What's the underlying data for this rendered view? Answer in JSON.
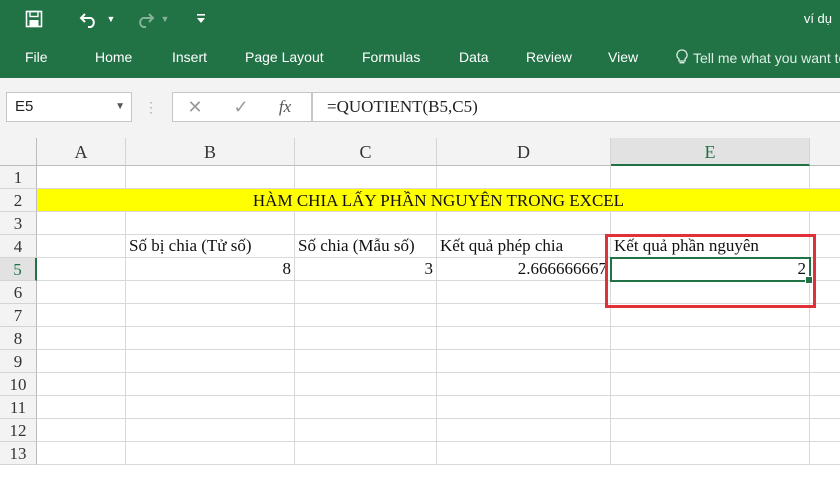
{
  "window": {
    "title": "ví dụ",
    "quick_access": {
      "save_icon": "save-icon",
      "undo_icon": "undo-icon",
      "redo_icon": "redo-icon",
      "customize_icon": "customize-icon"
    }
  },
  "ribbon": {
    "tabs": [
      "File",
      "Home",
      "Insert",
      "Page Layout",
      "Formulas",
      "Data",
      "Review",
      "View"
    ],
    "tell_me": "Tell me what you want to do"
  },
  "formula_bar": {
    "name_box": "E5",
    "cancel_symbol": "✕",
    "enter_symbol": "✓",
    "fx_symbol": "fx",
    "formula": "=QUOTIENT(B5,C5)"
  },
  "sheet": {
    "columns": [
      "A",
      "B",
      "C",
      "D",
      "E"
    ],
    "rows": [
      "1",
      "2",
      "3",
      "4",
      "5",
      "6",
      "7",
      "8",
      "9",
      "10",
      "11",
      "12",
      "13"
    ],
    "banner": "HÀM CHIA LẤY PHẦN NGUYÊN TRONG EXCEL",
    "headers": {
      "b4": "Số bị chia (Tử số)",
      "c4": "Số chia (Mẫu số)",
      "d4": "Kết quả phép chia",
      "e4": "Kết quả phần nguyên"
    },
    "values": {
      "b5": "8",
      "c5": "3",
      "d5": "2.666666667",
      "e5": "2"
    },
    "active_cell": "E5"
  },
  "colors": {
    "excel_green": "#217346",
    "banner_yellow": "#ffff00",
    "highlight_red": "#e0303a"
  }
}
